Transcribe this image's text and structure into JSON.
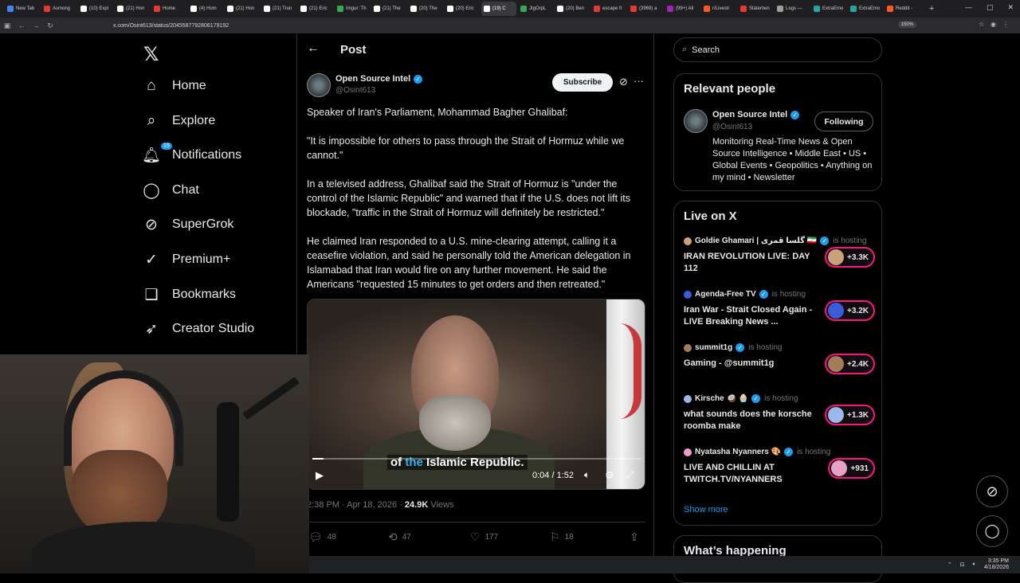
{
  "browser": {
    "tabs": [
      {
        "label": "New Tab",
        "color": "#4285f4"
      },
      {
        "label": "Asmong",
        "color": "#e53935"
      },
      {
        "label": "(10) Expl",
        "color": "#ffffff"
      },
      {
        "label": "(21) Hon",
        "color": "#ffffff"
      },
      {
        "label": "Home",
        "color": "#e53935"
      },
      {
        "label": "(4) Hom",
        "color": "#ffffff"
      },
      {
        "label": "(21) Hon",
        "color": "#ffffff"
      },
      {
        "label": "(21) Trun",
        "color": "#ffffff"
      },
      {
        "label": "(21) Eric",
        "color": "#ffffff"
      },
      {
        "label": "Imgur: Th",
        "color": "#34a853"
      },
      {
        "label": "(21) The",
        "color": "#ffffff"
      },
      {
        "label": "(20) The",
        "color": "#ffffff"
      },
      {
        "label": "(20) Eric",
        "color": "#ffffff"
      },
      {
        "label": "(19) C",
        "color": "#ffffff",
        "active": true
      },
      {
        "label": "JtgOrpL",
        "color": "#34a853"
      },
      {
        "label": "(20) Ben",
        "color": "#ffffff"
      },
      {
        "label": "escape fr",
        "color": "#e53935"
      },
      {
        "label": "(3969) a",
        "color": "#e53935"
      },
      {
        "label": "(99+) All",
        "color": "#9c27b0"
      },
      {
        "label": "r/Livestr",
        "color": "#ff5722"
      },
      {
        "label": "Statemen",
        "color": "#e53935"
      },
      {
        "label": "Logs —",
        "color": "#9e9e9e"
      },
      {
        "label": "ExtraEmo",
        "color": "#26a69a"
      },
      {
        "label": "ExtraEmo",
        "color": "#26a69a"
      },
      {
        "label": "Reddit -",
        "color": "#ff5722"
      }
    ],
    "new_tab": "+",
    "url": "x.com/Osint613/status/2045587792806179192",
    "zoom": "150%"
  },
  "sidebar": {
    "logo": "𝕏",
    "items": [
      {
        "label": "Home",
        "icon": "⌂",
        "name": "home"
      },
      {
        "label": "Explore",
        "icon": "⌕",
        "name": "explore"
      },
      {
        "label": "Notifications",
        "icon": "🔔︎",
        "name": "notifications",
        "badge": "19"
      },
      {
        "label": "Chat",
        "icon": "◯",
        "name": "chat"
      },
      {
        "label": "SuperGrok",
        "icon": "⊘",
        "name": "supergrok"
      },
      {
        "label": "Premium+",
        "icon": "✓",
        "name": "premium"
      },
      {
        "label": "Bookmarks",
        "icon": "❑",
        "name": "bookmarks"
      },
      {
        "label": "Creator Studio",
        "icon": "➶",
        "name": "creator-studio"
      }
    ]
  },
  "post": {
    "header_title": "Post",
    "author_name": "Open Source Intel",
    "author_handle": "@Osint613",
    "subscribe_label": "Subscribe",
    "paragraphs": [
      "Speaker of Iran's Parliament, Mohammad Bagher Ghalibaf:",
      "\"It is impossible for others to pass through the Strait of Hormuz while we cannot.\"",
      "In a televised address, Ghalibaf said the Strait of Hormuz is \"under the control of the Islamic Republic\" and warned that if the U.S. does not lift its blockade, \"traffic in the Strait of Hormuz will definitely be restricted.\"",
      "He claimed Iran responded to a U.S. mine-clearing attempt, calling it a ceasefire violation, and said he personally told the American delegation in Islamabad that Iran would fire on any further movement. He said the Americans \"requested 15 minutes to get orders and then retreated.\""
    ],
    "video": {
      "caption_pre": "of ",
      "caption_hl": "the",
      "caption_post": " Islamic Republic.",
      "time": "0:04 / 1:52",
      "progress": 0.035
    },
    "meta_time": "2:38 PM · Apr 18, 2026 · ",
    "meta_views": "24.9K",
    "meta_views_label": " Views",
    "actions": {
      "replies": "48",
      "reposts": "47",
      "likes": "177",
      "bookmarks": "18"
    }
  },
  "right": {
    "search_placeholder": "Search",
    "relevant": {
      "title": "Relevant people",
      "name": "Open Source Intel",
      "handle": "@Osint613",
      "follow_label": "Following",
      "bio": "Monitoring Real-Time News & Open Source Intelligence • Middle East • US • Global Events • Geopolitics • Anything on my mind • Newsletter"
    },
    "live": {
      "title": "Live on X",
      "items": [
        {
          "host": "Goldie Ghamari | گلسا قمری 🇮🇷",
          "status": "is hosting",
          "title": "IRAN REVOLUTION LIVE: DAY 112",
          "count": "+3.3K",
          "color": "#c9a27a"
        },
        {
          "host": "Agenda-Free TV",
          "status": "is hosting",
          "title": "Iran War - Strait Closed Again - LIVE Breaking News ...",
          "count": "+3.2K",
          "color": "#3b5bdb"
        },
        {
          "host": "summit1g",
          "status": "is hosting",
          "title": "Gaming - @summit1g",
          "count": "+2.4K",
          "color": "#a47c5a"
        },
        {
          "host": "Kirsche 🥥 🧁",
          "status": "is hosting",
          "title": "what sounds does the korsche roomba make",
          "count": "+1.3K",
          "color": "#9ab8e8"
        },
        {
          "host": "Nyatasha Nyanners 🎨",
          "status": "is hosting",
          "title": "LIVE AND CHILLIN AT TWITCH.TV/NYANNERS",
          "count": "+931",
          "color": "#e8a0c8"
        }
      ],
      "show_more": "Show more"
    },
    "whats_happening": "What’s happening"
  },
  "taskbar": {
    "time": "3:35 PM",
    "date": "4/18/2026"
  }
}
